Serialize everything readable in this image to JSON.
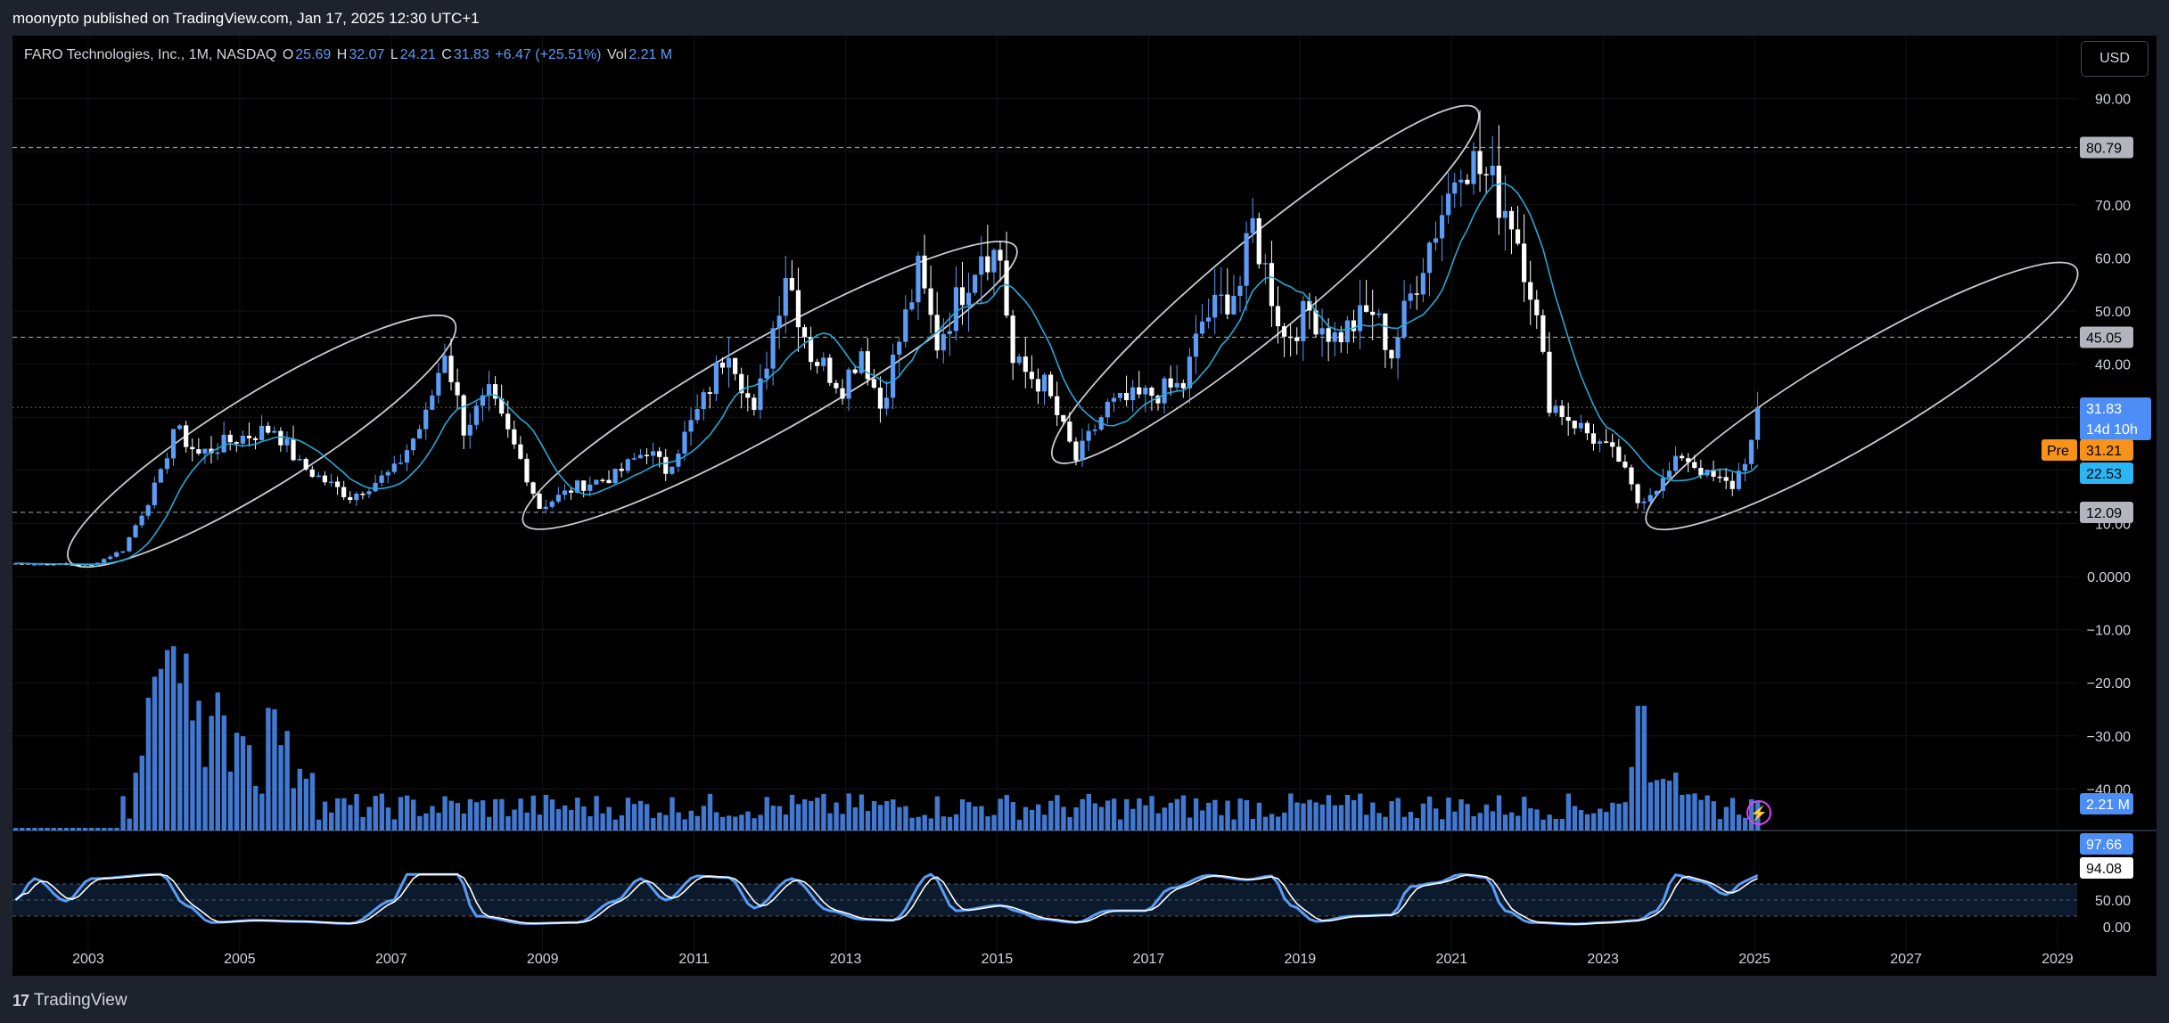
{
  "header": {
    "published_line": "moonypto published on TradingView.com, Jan 17, 2025 12:30 UTC+1"
  },
  "legend": {
    "symbol": "FARO Technologies, Inc., 1M, NASDAQ",
    "open_label": "O",
    "open": "25.69",
    "high_label": "H",
    "high": "32.07",
    "low_label": "L",
    "low": "24.21",
    "close_label": "C",
    "close": "31.83",
    "change": "+6.47 (+25.51%)",
    "vol_label": "Vol",
    "volume": "2.21 M"
  },
  "currency": "USD",
  "footer": {
    "brand": "TradingView",
    "logo_glyph": "17"
  },
  "colors": {
    "bull": "#5b9cf6",
    "bear": "#ffffff",
    "ma": "#26a8d6",
    "stoch_k": "#5b9cf6",
    "stoch_d": "#ffffff",
    "current_price_tag": "#4c8ef6",
    "pre_tag": "#f7931a",
    "ma_tag": "#2ab6f5"
  },
  "price_tags": [
    {
      "id": "hline-high",
      "label": "80.79",
      "value": 80.79,
      "bg": "#b2b5be",
      "fg": "#000000"
    },
    {
      "id": "hline-mid",
      "label": "45.05",
      "value": 45.05,
      "bg": "#b2b5be",
      "fg": "#000000"
    },
    {
      "id": "hline-low",
      "label": "12.09",
      "value": 12.09,
      "bg": "#b2b5be",
      "fg": "#000000"
    },
    {
      "id": "current",
      "label": "31.83",
      "sub": "14d 10h",
      "value": 31.83,
      "bg": "#4c8ef6",
      "fg": "#ffffff"
    },
    {
      "id": "pre",
      "label": "31.21",
      "prefix": "Pre",
      "value": 31.21,
      "bg": "#f7931a",
      "fg": "#000000"
    },
    {
      "id": "ma",
      "label": "22.53",
      "value": 22.53,
      "bg": "#2ab6f5",
      "fg": "#000000"
    },
    {
      "id": "volume",
      "label": "2.21 M",
      "bg": "#4c8ef6",
      "fg": "#ffffff"
    },
    {
      "id": "stoch-k",
      "label": "97.66",
      "bg": "#4c8ef6",
      "fg": "#ffffff"
    },
    {
      "id": "stoch-d",
      "label": "94.08",
      "bg": "#ffffff",
      "fg": "#000000"
    }
  ],
  "chart_data": {
    "type": "candlestick",
    "title": "FARO Technologies, Inc., 1M, NASDAQ",
    "currency": "USD",
    "xlim": [
      "2002-01",
      "2025-05"
    ],
    "x_tick_labels": [
      "2003",
      "2005",
      "2007",
      "2009",
      "2011",
      "2013",
      "2015",
      "2017",
      "2019",
      "2021",
      "2023",
      "2025",
      "2027",
      "2029"
    ],
    "y_tick_labels": [
      "90.00",
      "80.00",
      "70.00",
      "60.00",
      "50.00",
      "40.00",
      "30.00",
      "20.00",
      "10.00",
      "0.0000",
      "−10.00",
      "−20.00",
      "−30.00",
      "−40.00"
    ],
    "y_tick_values": [
      90,
      80,
      70,
      60,
      50,
      40,
      30,
      20,
      10,
      0,
      -10,
      -20,
      -30,
      -40
    ],
    "stoch_tick_labels": [
      "50.00",
      "0.00"
    ],
    "stoch_tick_values": [
      50,
      0
    ],
    "price_anchors": [
      [
        "2002-01",
        2.5
      ],
      [
        "2003-01",
        2.2
      ],
      [
        "2003-06",
        5
      ],
      [
        "2003-12",
        19
      ],
      [
        "2004-02",
        28
      ],
      [
        "2004-06",
        23
      ],
      [
        "2004-12",
        26
      ],
      [
        "2005-06",
        28
      ],
      [
        "2005-10",
        21
      ],
      [
        "2006-06",
        15
      ],
      [
        "2007-01",
        20
      ],
      [
        "2007-06",
        30
      ],
      [
        "2007-09",
        43
      ],
      [
        "2007-12",
        28
      ],
      [
        "2008-04",
        34
      ],
      [
        "2008-09",
        22
      ],
      [
        "2008-12",
        13
      ],
      [
        "2009-06",
        17
      ],
      [
        "2009-12",
        19
      ],
      [
        "2010-05",
        24
      ],
      [
        "2010-08",
        20
      ],
      [
        "2011-02",
        33
      ],
      [
        "2011-06",
        44
      ],
      [
        "2011-10",
        30
      ],
      [
        "2012-03",
        58
      ],
      [
        "2012-07",
        42
      ],
      [
        "2012-12",
        36
      ],
      [
        "2013-03",
        43
      ],
      [
        "2013-06",
        32
      ],
      [
        "2013-12",
        57
      ],
      [
        "2014-03",
        44
      ],
      [
        "2014-10",
        62
      ],
      [
        "2015-01",
        60
      ],
      [
        "2015-03",
        40
      ],
      [
        "2015-08",
        36
      ],
      [
        "2016-01",
        22
      ],
      [
        "2016-06",
        32
      ],
      [
        "2017-06",
        36
      ],
      [
        "2017-09",
        48
      ],
      [
        "2018-03",
        55
      ],
      [
        "2018-05",
        66
      ],
      [
        "2018-10",
        45
      ],
      [
        "2019-02",
        50
      ],
      [
        "2019-06",
        45
      ],
      [
        "2019-12",
        50
      ],
      [
        "2020-03",
        42
      ],
      [
        "2020-08",
        60
      ],
      [
        "2020-12",
        72
      ],
      [
        "2021-02",
        80
      ],
      [
        "2021-06",
        75
      ],
      [
        "2021-10",
        68
      ],
      [
        "2022-01",
        55
      ],
      [
        "2022-04",
        33
      ],
      [
        "2022-09",
        28
      ],
      [
        "2023-03",
        22
      ],
      [
        "2023-06",
        14
      ],
      [
        "2023-10",
        18
      ],
      [
        "2024-01",
        23
      ],
      [
        "2024-05",
        19
      ],
      [
        "2024-09",
        17
      ],
      [
        "2024-12",
        25
      ],
      [
        "2025-01",
        31.83
      ]
    ],
    "hlines": [
      80.79,
      45.05,
      12.09
    ],
    "current_price": 31.83,
    "ellipses": [
      {
        "from": [
          "2002-10",
          3
        ],
        "to": [
          "2007-11",
          48
        ]
      },
      {
        "from": [
          "2008-10",
          10
        ],
        "to": [
          "2015-04",
          62
        ]
      },
      {
        "from": [
          "2015-10",
          22
        ],
        "to": [
          "2021-05",
          88
        ]
      },
      {
        "from": [
          "2023-08",
          10
        ],
        "to": [
          "2029-04",
          58
        ]
      }
    ],
    "volume_last": "2.21 M",
    "stoch_last": {
      "k": 97.66,
      "d": 94.08
    },
    "stoch_anchors": [
      [
        "2002-01",
        50
      ],
      [
        "2002-04",
        90
      ],
      [
        "2002-09",
        48
      ],
      [
        "2003-01",
        90
      ],
      [
        "2003-12",
        98
      ],
      [
        "2004-04",
        40
      ],
      [
        "2004-08",
        8
      ],
      [
        "2005-03",
        12
      ],
      [
        "2005-09",
        10
      ],
      [
        "2006-06",
        6
      ],
      [
        "2007-01",
        50
      ],
      [
        "2007-03",
        98
      ],
      [
        "2007-11",
        98
      ],
      [
        "2008-02",
        20
      ],
      [
        "2008-10",
        6
      ],
      [
        "2009-06",
        8
      ],
      [
        "2009-12",
        48
      ],
      [
        "2010-04",
        90
      ],
      [
        "2010-08",
        50
      ],
      [
        "2011-01",
        95
      ],
      [
        "2011-06",
        92
      ],
      [
        "2011-10",
        35
      ],
      [
        "2012-04",
        90
      ],
      [
        "2012-10",
        30
      ],
      [
        "2013-03",
        14
      ],
      [
        "2013-08",
        12
      ],
      [
        "2014-02",
        98
      ],
      [
        "2014-06",
        30
      ],
      [
        "2015-01",
        40
      ],
      [
        "2015-04",
        28
      ],
      [
        "2015-07",
        15
      ],
      [
        "2016-01",
        8
      ],
      [
        "2016-06",
        30
      ],
      [
        "2016-12",
        30
      ],
      [
        "2017-04",
        72
      ],
      [
        "2017-10",
        96
      ],
      [
        "2018-04",
        88
      ],
      [
        "2018-08",
        95
      ],
      [
        "2018-11",
        40
      ],
      [
        "2019-03",
        10
      ],
      [
        "2019-09",
        20
      ],
      [
        "2020-03",
        22
      ],
      [
        "2020-06",
        75
      ],
      [
        "2020-10",
        82
      ],
      [
        "2021-02",
        98
      ],
      [
        "2021-06",
        92
      ],
      [
        "2021-09",
        30
      ],
      [
        "2022-01",
        8
      ],
      [
        "2022-08",
        5
      ],
      [
        "2023-01",
        8
      ],
      [
        "2023-06",
        12
      ],
      [
        "2023-09",
        30
      ],
      [
        "2023-12",
        97
      ],
      [
        "2024-04",
        85
      ],
      [
        "2024-08",
        60
      ],
      [
        "2024-11",
        85
      ],
      [
        "2025-01",
        96
      ]
    ]
  }
}
